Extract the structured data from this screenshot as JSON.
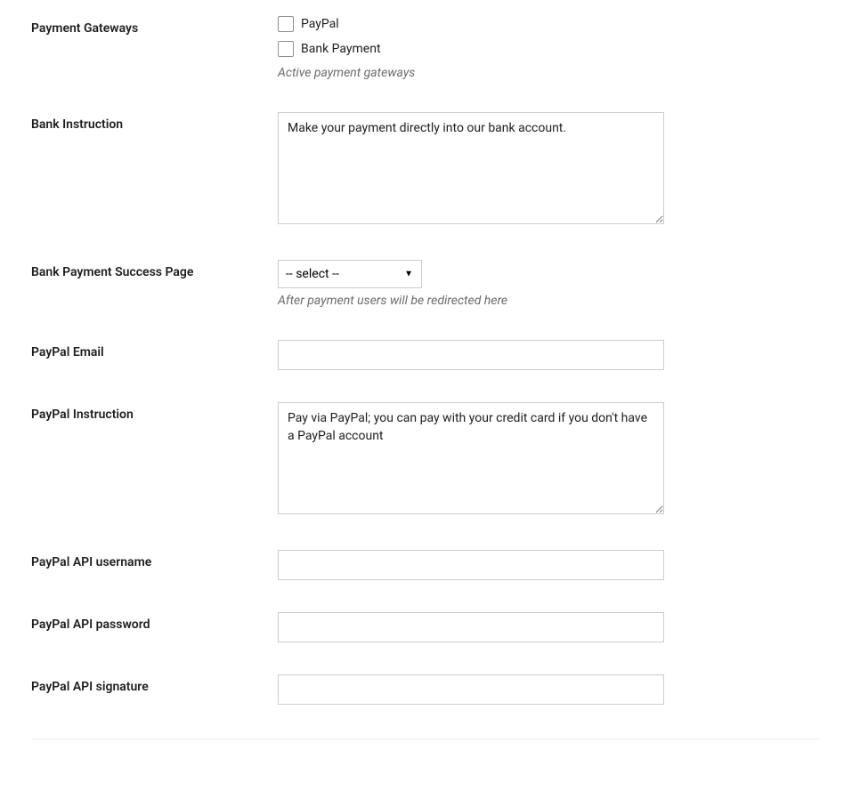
{
  "fields": {
    "payment_gateways": {
      "label": "Payment Gateways",
      "options": {
        "paypal": "PayPal",
        "bank": "Bank Payment"
      },
      "description": "Active payment gateways"
    },
    "bank_instruction": {
      "label": "Bank Instruction",
      "value": "Make your payment directly into our bank account."
    },
    "bank_success_page": {
      "label": "Bank Payment Success Page",
      "selected": "-- select --",
      "description": "After payment users will be redirected here"
    },
    "paypal_email": {
      "label": "PayPal Email",
      "value": ""
    },
    "paypal_instruction": {
      "label": "PayPal Instruction",
      "value": "Pay via PayPal; you can pay with your credit card if you don't have a PayPal account"
    },
    "paypal_api_username": {
      "label": "PayPal API username",
      "value": ""
    },
    "paypal_api_password": {
      "label": "PayPal API password",
      "value": ""
    },
    "paypal_api_signature": {
      "label": "PayPal API signature",
      "value": ""
    }
  }
}
